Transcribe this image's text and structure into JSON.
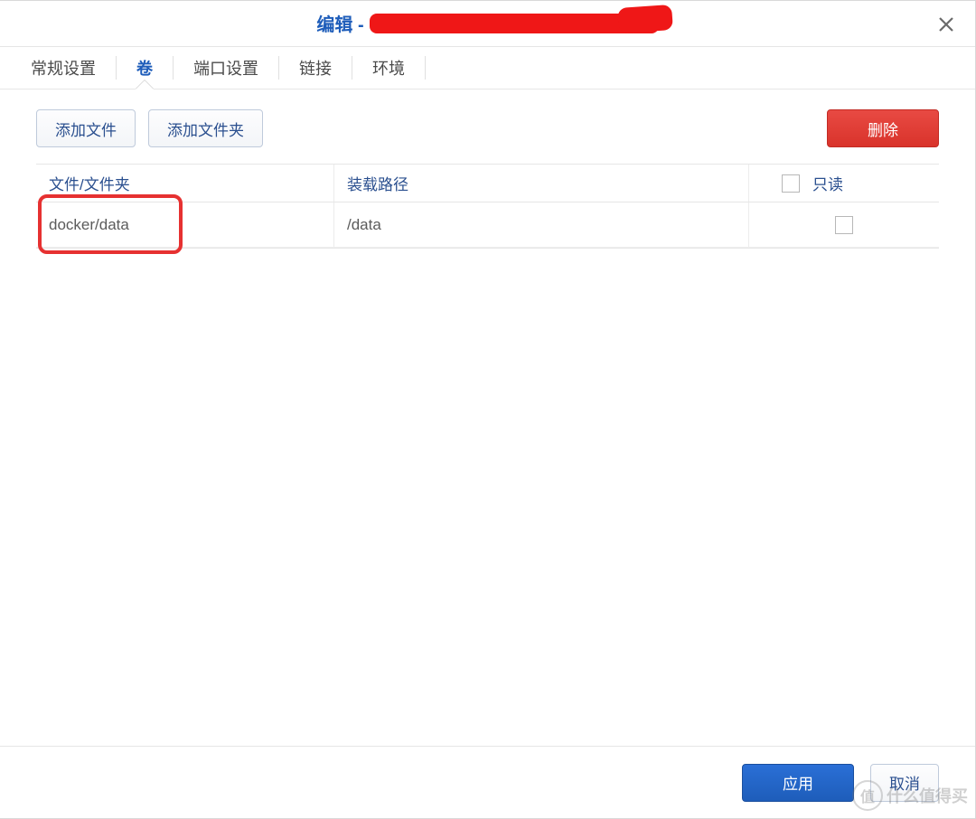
{
  "header": {
    "title_prefix": "编辑 - "
  },
  "tabs": [
    {
      "label": "常规设置",
      "active": false
    },
    {
      "label": "卷",
      "active": true
    },
    {
      "label": "端口设置",
      "active": false
    },
    {
      "label": "链接",
      "active": false
    },
    {
      "label": "环境",
      "active": false
    }
  ],
  "toolbar": {
    "add_file": "添加文件",
    "add_folder": "添加文件夹",
    "delete": "删除"
  },
  "table": {
    "columns": {
      "file_folder": "文件/文件夹",
      "mount_path": "装载路径",
      "readonly": "只读"
    },
    "rows": [
      {
        "file": "docker/data",
        "mount": "/data",
        "readonly": false
      }
    ]
  },
  "footer": {
    "apply": "应用",
    "cancel": "取消"
  },
  "watermark": {
    "badge": "值",
    "text": "什么值得买"
  }
}
